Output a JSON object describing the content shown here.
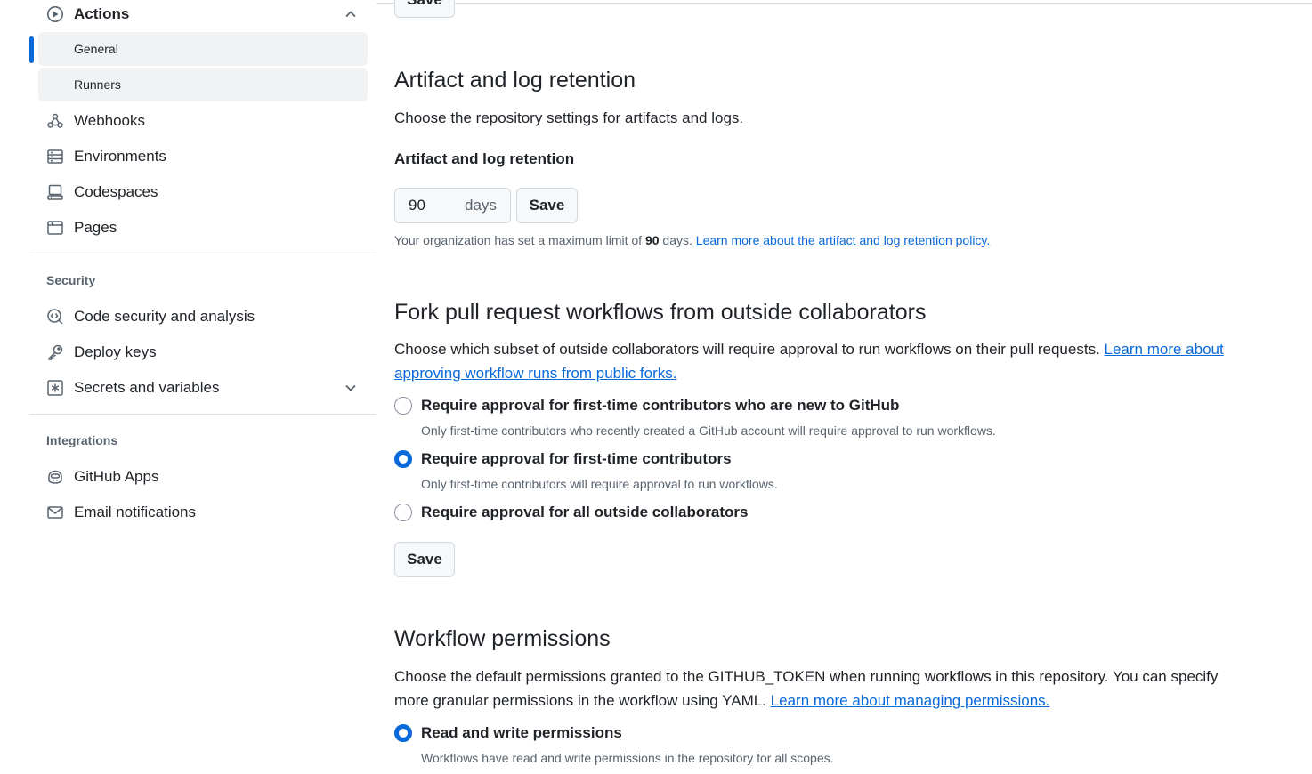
{
  "sidebar": {
    "actions": {
      "label": "Actions",
      "icon": "play-icon",
      "expanded": true
    },
    "actions_sub": [
      {
        "label": "General",
        "active": true
      },
      {
        "label": "Runners"
      }
    ],
    "items": [
      {
        "label": "Webhooks",
        "icon": "webhook-icon"
      },
      {
        "label": "Environments",
        "icon": "server-icon"
      },
      {
        "label": "Codespaces",
        "icon": "codespaces-icon"
      },
      {
        "label": "Pages",
        "icon": "browser-icon"
      }
    ],
    "security": {
      "heading": "Security",
      "items": [
        {
          "label": "Code security and analysis",
          "icon": "codescan-icon"
        },
        {
          "label": "Deploy keys",
          "icon": "key-icon"
        },
        {
          "label": "Secrets and variables",
          "icon": "asterisk-icon",
          "expandable": true
        }
      ]
    },
    "integrations": {
      "heading": "Integrations",
      "items": [
        {
          "label": "GitHub Apps",
          "icon": "copilot-icon"
        },
        {
          "label": "Email notifications",
          "icon": "mail-icon"
        }
      ]
    }
  },
  "top_save": {
    "label": "Save"
  },
  "retention": {
    "title": "Artifact and log retention",
    "description": "Choose the repository settings for artifacts and logs.",
    "field_label": "Artifact and log retention",
    "value": "90",
    "unit": "days",
    "save_label": "Save",
    "note_prefix": "Your organization has set a maximum limit of ",
    "note_limit": "90",
    "note_suffix": " days. ",
    "note_link": "Learn more about the artifact and log retention policy."
  },
  "fork": {
    "title": "Fork pull request workflows from outside collaborators",
    "description": "Choose which subset of outside collaborators will require approval to run workflows on their pull requests. ",
    "link": "Learn more about approving workflow runs from public forks.",
    "options": [
      {
        "label": "Require approval for first-time contributors who are new to GitHub",
        "help": "Only first-time contributors who recently created a GitHub account will require approval to run workflows.",
        "checked": false
      },
      {
        "label": "Require approval for first-time contributors",
        "help": "Only first-time contributors will require approval to run workflows.",
        "checked": true
      },
      {
        "label": "Require approval for all outside collaborators",
        "help": "",
        "checked": false
      }
    ],
    "save_label": "Save"
  },
  "workflow": {
    "title": "Workflow permissions",
    "description": "Choose the default permissions granted to the GITHUB_TOKEN when running workflows in this repository. You can specify more granular permissions in the workflow using YAML. ",
    "link": "Learn more about managing permissions.",
    "options": [
      {
        "label": "Read and write permissions",
        "help": "Workflows have read and write permissions in the repository for all scopes.",
        "checked": true
      }
    ]
  },
  "colors": {
    "accent": "#0969da",
    "active_bar": "#0969da",
    "subnav_bg": "#f1f2f4"
  }
}
